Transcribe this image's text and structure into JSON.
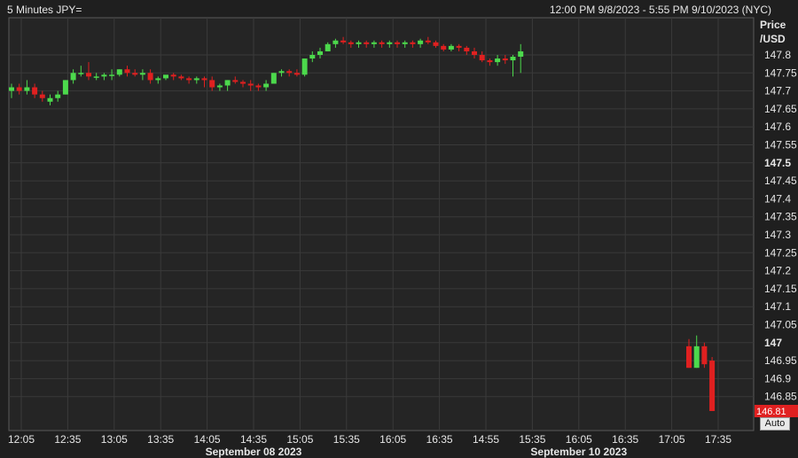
{
  "header": {
    "title": "5 Minutes JPY=",
    "date_range": "12:00 PM 9/8/2023 - 5:55 PM 9/10/2023 (NYC)"
  },
  "controls": {
    "auto_label": "Auto"
  },
  "colors": {
    "up": "#4cd94c",
    "down": "#e02020",
    "background": "#1f1f1f",
    "plot": "#252525",
    "grid": "#3a3a3a",
    "last_price_bg": "#e02020"
  },
  "chart_data": {
    "type": "candlestick",
    "title": "5 Minutes JPY=",
    "ylabel": "Price /USD",
    "ylabel_lines": [
      "Price",
      "/USD"
    ],
    "ylim": [
      146.8,
      147.86
    ],
    "yticks": [
      "147.8",
      "147.75",
      "147.7",
      "147.65",
      "147.6",
      "147.55",
      "147.5",
      "147.45",
      "147.4",
      "147.35",
      "147.3",
      "147.25",
      "147.2",
      "147.15",
      "147.1",
      "147.05",
      "147",
      "146.95",
      "146.9",
      "146.85"
    ],
    "bold_ticks": [
      "147.5",
      "147"
    ],
    "xticks": [
      "12:05",
      "12:35",
      "13:05",
      "13:35",
      "14:05",
      "14:35",
      "15:05",
      "15:35",
      "16:05",
      "16:35",
      "14:55",
      "15:35",
      "16:05",
      "16:35",
      "17:05",
      "17:35"
    ],
    "date_labels": [
      {
        "text": "September 08 2023",
        "tick": "14:35"
      },
      {
        "text": "September 10 2023",
        "tick": "16:05"
      }
    ],
    "last_price": "146.81",
    "grid": true,
    "candles": [
      [
        147.7,
        147.72,
        147.68,
        147.71
      ],
      [
        147.71,
        147.72,
        147.69,
        147.7
      ],
      [
        147.7,
        147.73,
        147.69,
        147.71
      ],
      [
        147.71,
        147.72,
        147.68,
        147.69
      ],
      [
        147.69,
        147.7,
        147.67,
        147.68
      ],
      [
        147.67,
        147.69,
        147.66,
        147.68
      ],
      [
        147.68,
        147.7,
        147.67,
        147.69
      ],
      [
        147.69,
        147.73,
        147.69,
        147.73
      ],
      [
        147.73,
        147.76,
        147.72,
        147.75
      ],
      [
        147.75,
        147.77,
        147.74,
        147.75
      ],
      [
        147.75,
        147.78,
        147.73,
        147.74
      ],
      [
        147.74,
        147.75,
        147.73,
        147.74
      ],
      [
        147.74,
        147.75,
        147.73,
        147.745
      ],
      [
        147.745,
        147.76,
        147.73,
        147.745
      ],
      [
        147.745,
        147.76,
        147.74,
        147.76
      ],
      [
        147.76,
        147.77,
        147.74,
        147.75
      ],
      [
        147.75,
        147.76,
        147.74,
        147.745
      ],
      [
        147.745,
        147.76,
        147.73,
        147.75
      ],
      [
        147.75,
        147.76,
        147.72,
        147.73
      ],
      [
        147.73,
        147.74,
        147.72,
        147.735
      ],
      [
        147.735,
        147.74,
        147.73,
        147.745
      ],
      [
        147.745,
        147.75,
        147.73,
        147.74
      ],
      [
        147.74,
        147.745,
        147.73,
        147.735
      ],
      [
        147.735,
        147.74,
        147.72,
        147.73
      ],
      [
        147.73,
        147.74,
        147.72,
        147.735
      ],
      [
        147.735,
        147.74,
        147.71,
        147.73
      ],
      [
        147.73,
        147.74,
        147.7,
        147.71
      ],
      [
        147.71,
        147.72,
        147.7,
        147.715
      ],
      [
        147.715,
        147.73,
        147.7,
        147.73
      ],
      [
        147.73,
        147.74,
        147.72,
        147.725
      ],
      [
        147.725,
        147.73,
        147.71,
        147.72
      ],
      [
        147.72,
        147.73,
        147.7,
        147.715
      ],
      [
        147.715,
        147.72,
        147.7,
        147.71
      ],
      [
        147.71,
        147.73,
        147.7,
        147.72
      ],
      [
        147.72,
        147.75,
        147.72,
        147.75
      ],
      [
        147.75,
        147.76,
        147.74,
        147.755
      ],
      [
        147.755,
        147.76,
        147.74,
        147.75
      ],
      [
        147.75,
        147.76,
        147.74,
        147.745
      ],
      [
        147.745,
        147.79,
        147.74,
        147.79
      ],
      [
        147.79,
        147.81,
        147.78,
        147.8
      ],
      [
        147.8,
        147.82,
        147.79,
        147.81
      ],
      [
        147.81,
        147.835,
        147.81,
        147.83
      ],
      [
        147.83,
        147.845,
        147.82,
        147.84
      ],
      [
        147.84,
        147.85,
        147.83,
        147.835
      ],
      [
        147.835,
        147.84,
        147.82,
        147.83
      ],
      [
        147.83,
        147.84,
        147.82,
        147.835
      ],
      [
        147.835,
        147.84,
        147.82,
        147.83
      ],
      [
        147.83,
        147.84,
        147.82,
        147.835
      ],
      [
        147.835,
        147.84,
        147.82,
        147.83
      ],
      [
        147.83,
        147.84,
        147.82,
        147.835
      ],
      [
        147.835,
        147.84,
        147.82,
        147.83
      ],
      [
        147.83,
        147.84,
        147.82,
        147.835
      ],
      [
        147.835,
        147.84,
        147.82,
        147.83
      ],
      [
        147.83,
        147.845,
        147.82,
        147.84
      ],
      [
        147.84,
        147.85,
        147.83,
        147.835
      ],
      [
        147.835,
        147.84,
        147.82,
        147.825
      ],
      [
        147.825,
        147.83,
        147.81,
        147.815
      ],
      [
        147.815,
        147.83,
        147.81,
        147.825
      ],
      [
        147.825,
        147.83,
        147.81,
        147.82
      ],
      [
        147.82,
        147.825,
        147.8,
        147.81
      ],
      [
        147.81,
        147.82,
        147.79,
        147.8
      ],
      [
        147.8,
        147.81,
        147.78,
        147.785
      ],
      [
        147.785,
        147.79,
        147.77,
        147.78
      ],
      [
        147.78,
        147.8,
        147.77,
        147.79
      ],
      [
        147.79,
        147.8,
        147.775,
        147.785
      ],
      [
        147.785,
        147.8,
        147.74,
        147.795
      ],
      [
        147.795,
        147.83,
        147.75,
        147.81
      ],
      [
        146.99,
        147.01,
        146.93,
        146.93
      ],
      [
        146.93,
        147.02,
        146.93,
        146.99
      ],
      [
        146.99,
        147.0,
        146.93,
        146.94
      ],
      [
        146.95,
        146.96,
        146.81,
        146.81
      ]
    ]
  }
}
